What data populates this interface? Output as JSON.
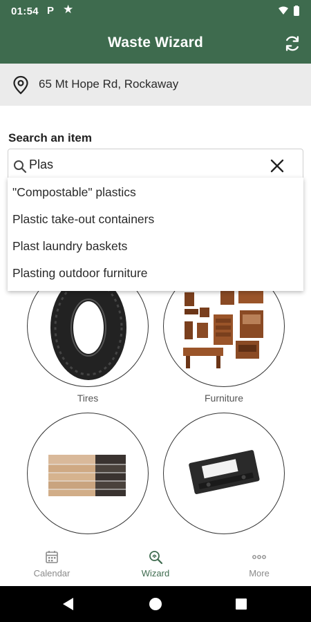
{
  "status_bar": {
    "time": "01:54",
    "p_icon": "P",
    "star_icon": "★"
  },
  "app_bar": {
    "title": "Waste Wizard",
    "refresh_icon": "refresh-icon"
  },
  "address": {
    "text": "65 Mt Hope Rd, Rockaway",
    "icon": "location-pin-icon"
  },
  "search": {
    "label": "Search an item",
    "value": "Plas",
    "suggestions": [
      "\"Compostable\" plastics",
      "Plastic take-out containers",
      "Plast laundry baskets",
      "Plasting outdoor furniture"
    ]
  },
  "tiles": [
    {
      "caption": "Tires"
    },
    {
      "caption": "Furniture"
    },
    {
      "caption": ""
    },
    {
      "caption": ""
    }
  ],
  "bottom_nav": {
    "items": [
      {
        "label": "Calendar",
        "icon": "calendar-icon"
      },
      {
        "label": "Wizard",
        "icon": "wizard-search-icon",
        "active": true
      },
      {
        "label": "More",
        "icon": "more-icon"
      }
    ]
  },
  "colors": {
    "primary": "#3e6b4e",
    "address_bg": "#ebebeb",
    "nav_inactive": "#8a8a8a"
  }
}
